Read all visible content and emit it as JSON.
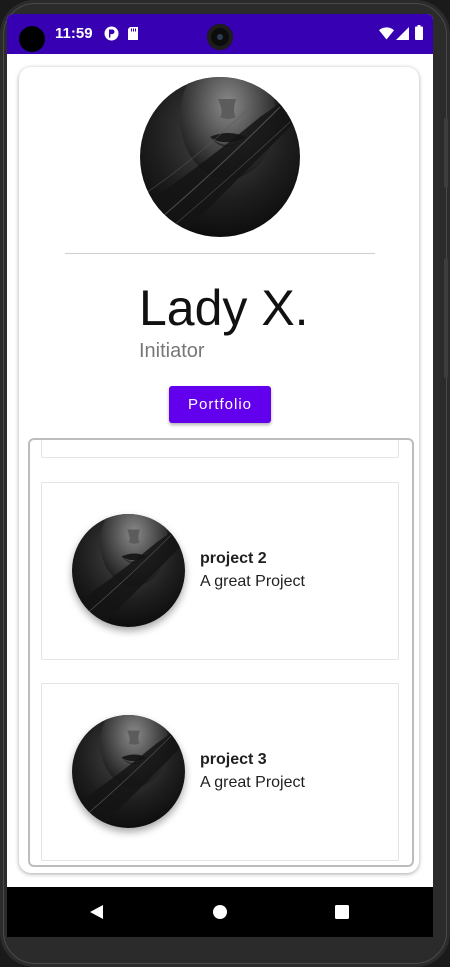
{
  "status_bar": {
    "time": "11:59",
    "background": "#3700b3",
    "icons": [
      "app-badge-icon",
      "sd-card-icon",
      "wifi-icon",
      "signal-icon",
      "battery-icon"
    ]
  },
  "profile": {
    "name": "Lady X.",
    "role": "Initiator",
    "portfolio_label": "Portfolio",
    "accent": "#6200ee"
  },
  "projects": [
    {
      "title": "project 2",
      "description": "A great Project"
    },
    {
      "title": "project 3",
      "description": "A great Project"
    }
  ],
  "nav_bar": {
    "buttons": [
      "back-icon",
      "home-icon",
      "recents-icon"
    ]
  }
}
